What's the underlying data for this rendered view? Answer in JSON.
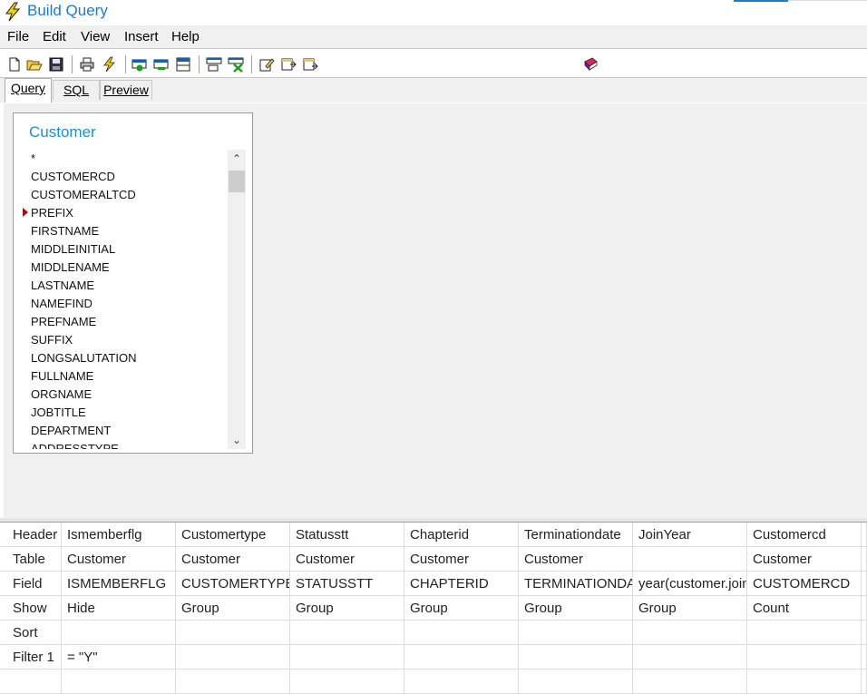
{
  "window": {
    "title": "Build Query"
  },
  "menu": [
    "File",
    "Edit",
    "View",
    "Insert",
    "Help"
  ],
  "toolbar": {
    "icons": [
      "new-icon",
      "open-icon",
      "save-icon",
      "print-icon",
      "run-icon",
      "add-table-icon",
      "remove-table-icon",
      "table-props-icon",
      "add-join-icon",
      "delete-join-icon",
      "edit-icon",
      "insert-column-icon",
      "append-column-icon",
      "book-icon"
    ]
  },
  "tabs": [
    {
      "label": "Query",
      "active": true
    },
    {
      "label": "SQL",
      "active": false
    },
    {
      "label": "Preview",
      "active": false
    }
  ],
  "table_box": {
    "title": "Customer",
    "fields": [
      "*",
      "CUSTOMERCD",
      "CUSTOMERALTCD",
      "PREFIX",
      "FIRSTNAME",
      "MIDDLEINITIAL",
      "MIDDLENAME",
      "LASTNAME",
      "NAMEFIND",
      "PREFNAME",
      "SUFFIX",
      "LONGSALUTATION",
      "FULLNAME",
      "ORGNAME",
      "JOBTITLE",
      "DEPARTMENT",
      "ADDRESSTYPE"
    ],
    "selected_field": "CUSTOMERCD"
  },
  "grid": {
    "row_labels": [
      "Header",
      "Table",
      "Field",
      "Show",
      "Sort",
      "Filter 1"
    ],
    "columns": [
      {
        "header": "Ismemberflg",
        "table": "Customer",
        "field": "ISMEMBERFLG",
        "show": "Hide",
        "sort": "",
        "filter1": "= \"Y\""
      },
      {
        "header": "Customertype",
        "table": "Customer",
        "field": "CUSTOMERTYPE",
        "show": "Group",
        "sort": "",
        "filter1": ""
      },
      {
        "header": "Statusstt",
        "table": "Customer",
        "field": "STATUSSTT",
        "show": "Group",
        "sort": "",
        "filter1": ""
      },
      {
        "header": "Chapterid",
        "table": "Customer",
        "field": "CHAPTERID",
        "show": "Group",
        "sort": "",
        "filter1": ""
      },
      {
        "header": "Terminationdate",
        "table": "Customer",
        "field": "TERMINATIONDATE",
        "show": "Group",
        "sort": "",
        "filter1": ""
      },
      {
        "header": "JoinYear",
        "table": "",
        "field": "year(customer.joindate)",
        "show": "Group",
        "sort": "",
        "filter1": ""
      },
      {
        "header": "Customercd",
        "table": "Customer",
        "field": "CUSTOMERCD",
        "show": "Count",
        "sort": "",
        "filter1": ""
      }
    ]
  }
}
